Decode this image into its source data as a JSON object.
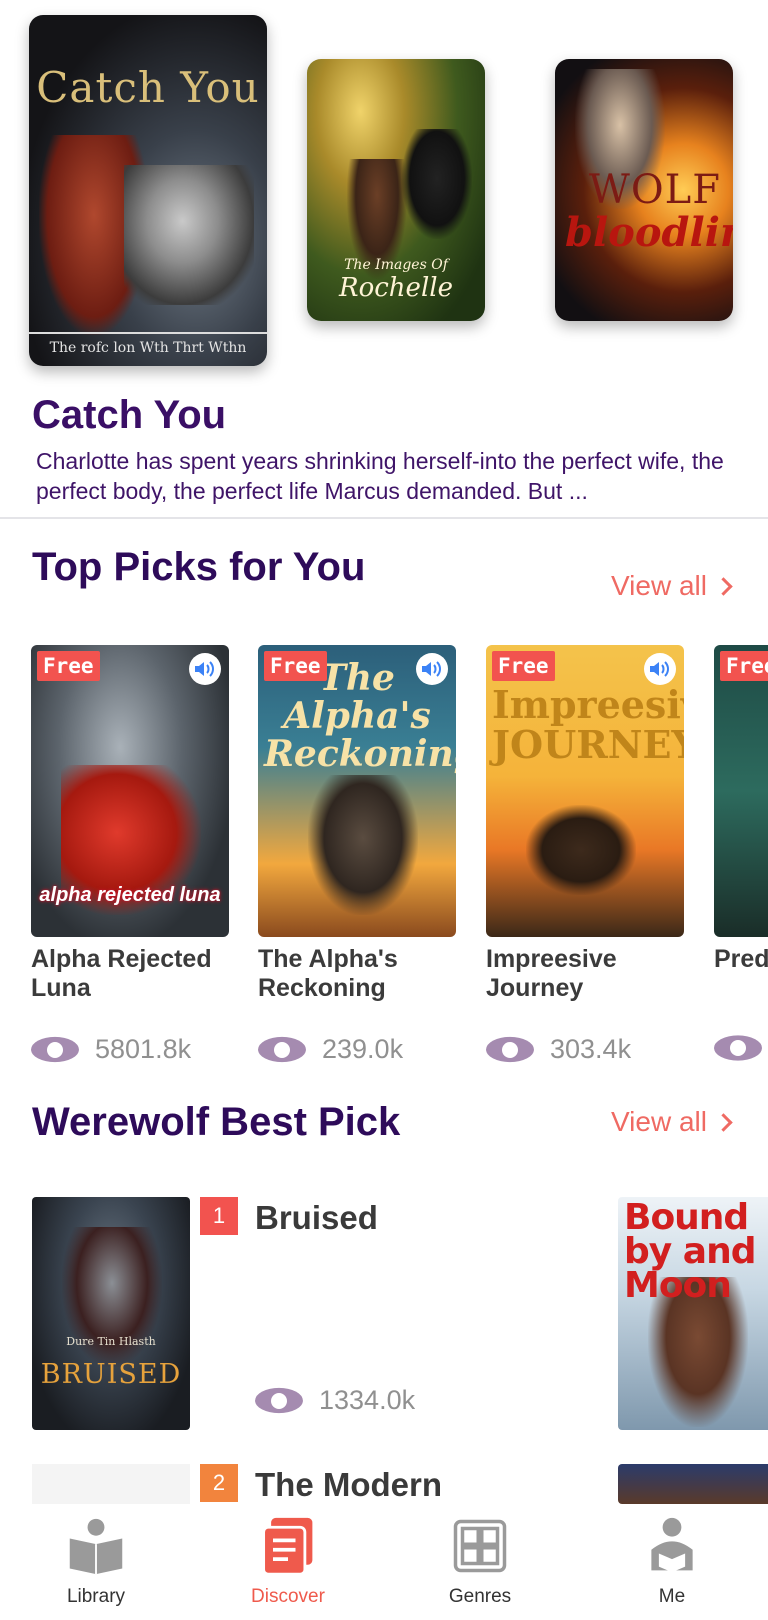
{
  "featured": {
    "covers": [
      {
        "title": "Catch You",
        "tagline": "The rofc  lon Wth Thrt Wthn"
      },
      {
        "subtitle": "The Images Of",
        "title": "Rochelle"
      },
      {
        "line1": "WOLF",
        "line2": "bloodline"
      }
    ],
    "title": "Catch You",
    "description": "Charlotte has spent years shrinking herself-into the perfect wife, the perfect body, the perfect life Marcus demanded. But ..."
  },
  "top_picks": {
    "title": "Top Picks for You",
    "view_all": "View all",
    "free_label": "Free",
    "items": [
      {
        "title": "Alpha Rejected Luna",
        "views": "5801.8k",
        "cover_text": "alpha rejected luna"
      },
      {
        "title": "The Alpha's Reckoning",
        "views": "239.0k",
        "cover_text": "The Alpha's Reckoning"
      },
      {
        "title": "Impreesive Journey",
        "views": "303.4k",
        "cover_text": "Impreesive JOURNEY"
      },
      {
        "title": "Pred",
        "views": ""
      }
    ]
  },
  "werewolf": {
    "title": "Werewolf Best Pick",
    "view_all": "View all",
    "items": [
      {
        "rank": "1",
        "title": "Bruised",
        "views": "1334.0k",
        "cover_text": "BRUISED",
        "cover_sub": "Dure Tin Hlasth",
        "rank_color": "#f2534f"
      },
      {
        "rank": "2",
        "title": "The Modern",
        "rank_color": "#f2843d"
      }
    ],
    "side_covers": [
      {
        "title": "Bound by and Moon"
      }
    ]
  },
  "nav": {
    "items": [
      {
        "label": "Library",
        "icon": "book-icon"
      },
      {
        "label": "Discover",
        "icon": "discover-icon",
        "active": true
      },
      {
        "label": "Genres",
        "icon": "grid-icon"
      },
      {
        "label": "Me",
        "icon": "reader-icon"
      }
    ]
  },
  "colors": {
    "accent": "#ef5a4c",
    "heading": "#2e0b5a",
    "free_badge": "#f2534f",
    "eye": "#a58bb0"
  }
}
